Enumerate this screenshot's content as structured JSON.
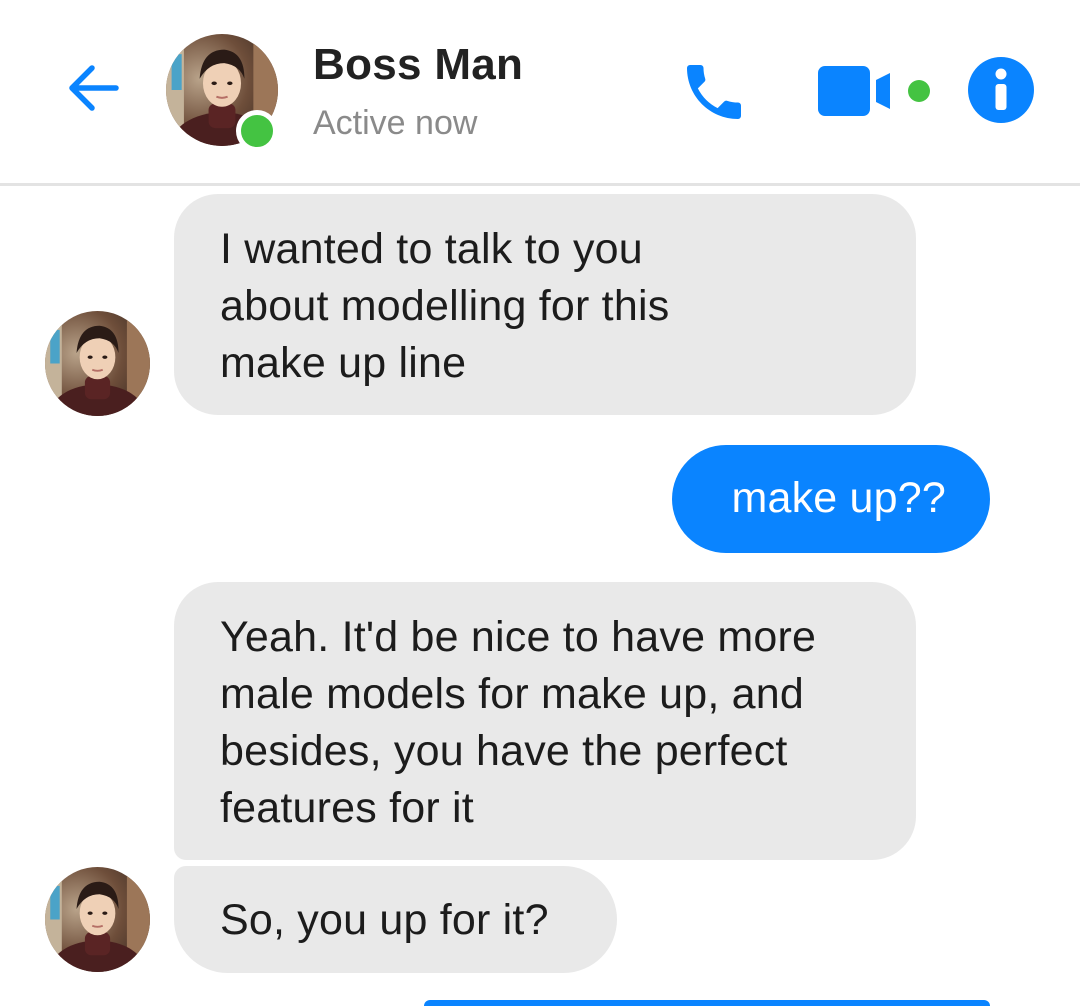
{
  "header": {
    "back_icon": "arrow-left-icon",
    "contact_name": "Boss Man",
    "status": "Active now",
    "presence": "online",
    "actions": {
      "call_icon": "phone-icon",
      "video_icon": "video-camera-icon",
      "info_icon": "info-icon"
    }
  },
  "colors": {
    "accent": "#0a84ff",
    "presence_green": "#44c342",
    "incoming_bubble": "#e9e9e9",
    "outgoing_bubble": "#0a84ff"
  },
  "messages": [
    {
      "direction": "incoming",
      "lines": [
        "I wanted to talk to you",
        "about modelling for this",
        "make up line"
      ]
    },
    {
      "direction": "outgoing",
      "lines": [
        "make up??"
      ]
    },
    {
      "direction": "incoming",
      "lines": [
        "Yeah. It'd be nice to have more",
        "male models for make up, and",
        "besides, you have the perfect",
        "features for it"
      ]
    },
    {
      "direction": "incoming",
      "lines": [
        "So, you up for it?"
      ]
    }
  ]
}
